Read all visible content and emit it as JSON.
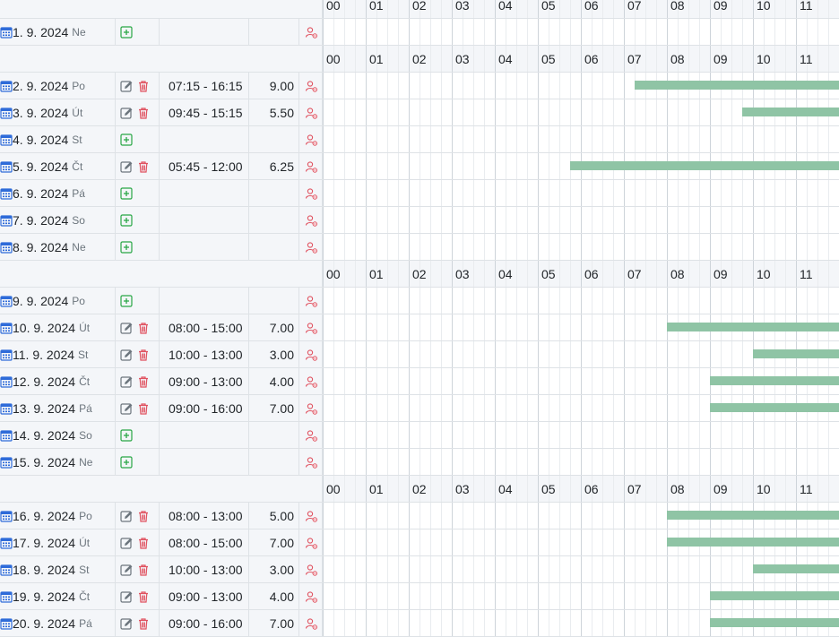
{
  "hours": [
    "00",
    "01",
    "02",
    "03",
    "04",
    "05",
    "06",
    "07",
    "08",
    "09",
    "10",
    "11"
  ],
  "colors": {
    "bar": "#8fc4a5",
    "add": "#28a745",
    "delete": "#e05260",
    "edit": "#6c757d",
    "calendar": "#2e6bd9",
    "user_icon": "#e05260"
  },
  "rows": [
    {
      "kind": "header"
    },
    {
      "kind": "day",
      "date": "1. 9. 2024",
      "dow": "Ne",
      "time": "",
      "hours": "",
      "shift": null
    },
    {
      "kind": "header"
    },
    {
      "kind": "day",
      "date": "2. 9. 2024",
      "dow": "Po",
      "time": "07:15 - 16:15",
      "hours": "9.00",
      "shift": [
        7.25,
        16.25
      ]
    },
    {
      "kind": "day",
      "date": "3. 9. 2024",
      "dow": "Út",
      "time": "09:45 - 15:15",
      "hours": "5.50",
      "shift": [
        9.75,
        15.25
      ]
    },
    {
      "kind": "day",
      "date": "4. 9. 2024",
      "dow": "St",
      "time": "",
      "hours": "",
      "shift": null
    },
    {
      "kind": "day",
      "date": "5. 9. 2024",
      "dow": "Čt",
      "time": "05:45 - 12:00",
      "hours": "6.25",
      "shift": [
        5.75,
        12.0
      ]
    },
    {
      "kind": "day",
      "date": "6. 9. 2024",
      "dow": "Pá",
      "time": "",
      "hours": "",
      "shift": null
    },
    {
      "kind": "day",
      "date": "7. 9. 2024",
      "dow": "So",
      "time": "",
      "hours": "",
      "shift": null
    },
    {
      "kind": "day",
      "date": "8. 9. 2024",
      "dow": "Ne",
      "time": "",
      "hours": "",
      "shift": null
    },
    {
      "kind": "header"
    },
    {
      "kind": "day",
      "date": "9. 9. 2024",
      "dow": "Po",
      "time": "",
      "hours": "",
      "shift": null
    },
    {
      "kind": "day",
      "date": "10. 9. 2024",
      "dow": "Út",
      "time": "08:00 - 15:00",
      "hours": "7.00",
      "shift": [
        8.0,
        15.0
      ]
    },
    {
      "kind": "day",
      "date": "11. 9. 2024",
      "dow": "St",
      "time": "10:00 - 13:00",
      "hours": "3.00",
      "shift": [
        10.0,
        13.0
      ]
    },
    {
      "kind": "day",
      "date": "12. 9. 2024",
      "dow": "Čt",
      "time": "09:00 - 13:00",
      "hours": "4.00",
      "shift": [
        9.0,
        13.0
      ]
    },
    {
      "kind": "day",
      "date": "13. 9. 2024",
      "dow": "Pá",
      "time": "09:00 - 16:00",
      "hours": "7.00",
      "shift": [
        9.0,
        16.0
      ]
    },
    {
      "kind": "day",
      "date": "14. 9. 2024",
      "dow": "So",
      "time": "",
      "hours": "",
      "shift": null
    },
    {
      "kind": "day",
      "date": "15. 9. 2024",
      "dow": "Ne",
      "time": "",
      "hours": "",
      "shift": null
    },
    {
      "kind": "header"
    },
    {
      "kind": "day",
      "date": "16. 9. 2024",
      "dow": "Po",
      "time": "08:00 - 13:00",
      "hours": "5.00",
      "shift": [
        8.0,
        13.0
      ]
    },
    {
      "kind": "day",
      "date": "17. 9. 2024",
      "dow": "Út",
      "time": "08:00 - 15:00",
      "hours": "7.00",
      "shift": [
        8.0,
        15.0
      ]
    },
    {
      "kind": "day",
      "date": "18. 9. 2024",
      "dow": "St",
      "time": "10:00 - 13:00",
      "hours": "3.00",
      "shift": [
        10.0,
        13.0
      ]
    },
    {
      "kind": "day",
      "date": "19. 9. 2024",
      "dow": "Čt",
      "time": "09:00 - 13:00",
      "hours": "4.00",
      "shift": [
        9.0,
        13.0
      ]
    },
    {
      "kind": "day",
      "date": "20. 9. 2024",
      "dow": "Pá",
      "time": "09:00 - 16:00",
      "hours": "7.00",
      "shift": [
        9.0,
        16.0
      ]
    }
  ]
}
